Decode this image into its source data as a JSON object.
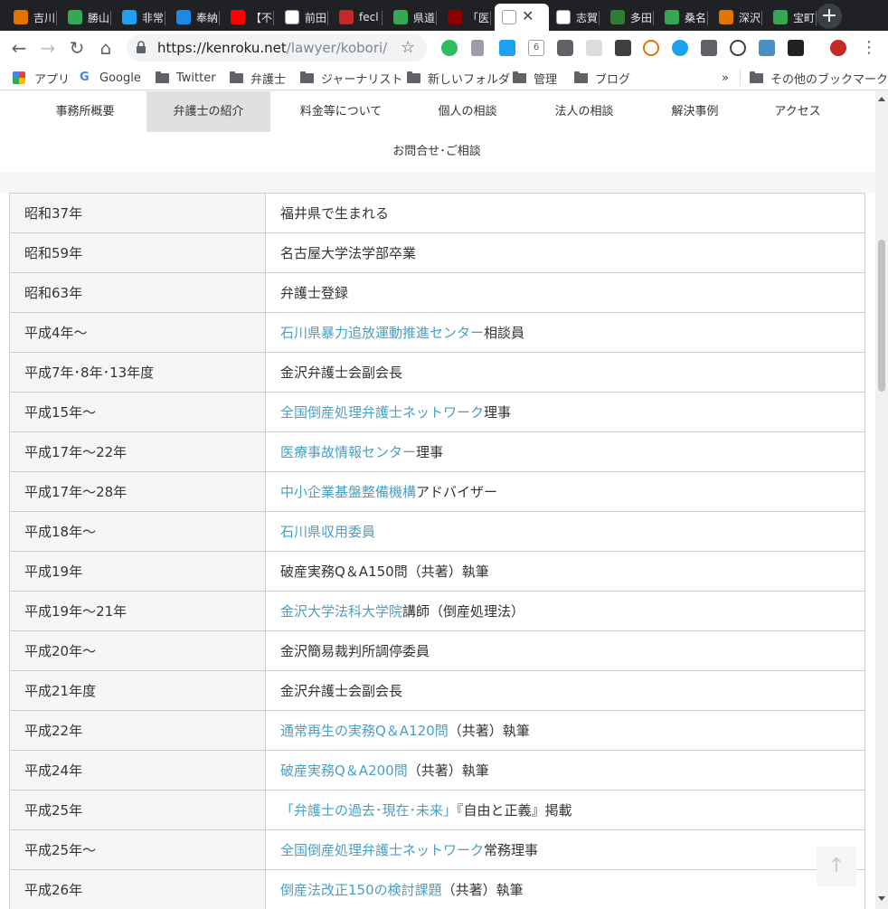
{
  "browser": {
    "tabs": [
      {
        "title": "吉川",
        "icon": "orange-sun-icon",
        "color": "#e37400"
      },
      {
        "title": "勝山",
        "icon": "maps-icon",
        "color": "#34a853"
      },
      {
        "title": "非常",
        "icon": "twitter-icon",
        "color": "#1da1f2"
      },
      {
        "title": "奉納",
        "icon": "blog-icon",
        "color": "#1e88e5"
      },
      {
        "title": "【不",
        "icon": "youtube-icon",
        "color": "#ff0000"
      },
      {
        "title": "前田",
        "icon": "google-icon",
        "color": "#ffffff"
      },
      {
        "title": "fecl",
        "icon": "f-icon",
        "color": "#c62828"
      },
      {
        "title": "県道",
        "icon": "maps-icon",
        "color": "#34a853"
      },
      {
        "title": "「医",
        "icon": "bug-icon",
        "color": "#8e0000"
      },
      {
        "title": "",
        "icon": "document-icon",
        "color": "#ffffff",
        "active": true
      },
      {
        "title": "志賀",
        "icon": "wikipedia-icon",
        "color": "#ffffff"
      },
      {
        "title": "多田",
        "icon": "bookmark-icon",
        "color": "#2e7d32"
      },
      {
        "title": "桑名",
        "icon": "maps-icon",
        "color": "#34a853"
      },
      {
        "title": "深沢",
        "icon": "orange-sun-icon",
        "color": "#e37400"
      },
      {
        "title": "宝町",
        "icon": "maps-icon",
        "color": "#34a853"
      }
    ],
    "url_host": "https://kenroku.net",
    "url_path": "/lawyer/kobori/",
    "bookmarks": [
      {
        "label": "アプリ",
        "type": "apps"
      },
      {
        "label": "Google",
        "type": "google"
      },
      {
        "label": "Twitter",
        "type": "folder"
      },
      {
        "label": "弁護士",
        "type": "folder"
      },
      {
        "label": "ジャーナリスト",
        "type": "folder"
      },
      {
        "label": "新しいフォルダ",
        "type": "folder"
      },
      {
        "label": "管理",
        "type": "folder"
      },
      {
        "label": "ブログ",
        "type": "folder"
      }
    ],
    "overflow": "»",
    "other_bookmarks": "その他のブックマーク"
  },
  "site_nav": [
    {
      "label": "事務所概要"
    },
    {
      "label": "弁護士の紹介",
      "active": true
    },
    {
      "label": "料金等について"
    },
    {
      "label": "個人の相談"
    },
    {
      "label": "法人の相談"
    },
    {
      "label": "解決事例"
    },
    {
      "label": "アクセス"
    },
    {
      "label": "お問合せ･ご相談"
    }
  ],
  "career": [
    {
      "year": "昭和37年",
      "parts": [
        {
          "text": "福井県で生まれる",
          "link": false
        }
      ]
    },
    {
      "year": "昭和59年",
      "parts": [
        {
          "text": "名古屋大学法学部卒業",
          "link": false
        }
      ]
    },
    {
      "year": "昭和63年",
      "parts": [
        {
          "text": "弁護士登録",
          "link": false
        }
      ]
    },
    {
      "year": "平成4年〜",
      "parts": [
        {
          "text": "石川県暴力追放運動推進センター",
          "link": true
        },
        {
          "text": "相談員",
          "link": false
        }
      ]
    },
    {
      "year": "平成7年･8年･13年度",
      "parts": [
        {
          "text": "金沢弁護士会副会長",
          "link": false
        }
      ]
    },
    {
      "year": "平成15年〜",
      "parts": [
        {
          "text": "全国倒産処理弁護士ネットワーク",
          "link": true
        },
        {
          "text": "理事",
          "link": false
        }
      ]
    },
    {
      "year": "平成17年〜22年",
      "parts": [
        {
          "text": "医療事故情報センター",
          "link": true
        },
        {
          "text": "理事",
          "link": false
        }
      ]
    },
    {
      "year": "平成17年〜28年",
      "parts": [
        {
          "text": "中小企業基盤整備機構",
          "link": true
        },
        {
          "text": "アドバイザー",
          "link": false
        }
      ]
    },
    {
      "year": "平成18年〜",
      "parts": [
        {
          "text": "石川県収用委員",
          "link": true
        }
      ]
    },
    {
      "year": "平成19年",
      "parts": [
        {
          "text": "破産実務Q＆A150問（共著）執筆",
          "link": false
        }
      ]
    },
    {
      "year": "平成19年〜21年",
      "parts": [
        {
          "text": "金沢大学法科大学院",
          "link": true
        },
        {
          "text": "講師（倒産処理法）",
          "link": false
        }
      ]
    },
    {
      "year": "平成20年〜",
      "parts": [
        {
          "text": "金沢簡易裁判所調停委員",
          "link": false
        }
      ]
    },
    {
      "year": "平成21年度",
      "parts": [
        {
          "text": "金沢弁護士会副会長",
          "link": false
        }
      ]
    },
    {
      "year": "平成22年",
      "parts": [
        {
          "text": "通常再生の実務Q＆A120問",
          "link": true
        },
        {
          "text": "（共著）執筆",
          "link": false
        }
      ]
    },
    {
      "year": "平成24年",
      "parts": [
        {
          "text": "破産実務Q＆A200問",
          "link": true
        },
        {
          "text": "（共著）執筆",
          "link": false
        }
      ]
    },
    {
      "year": "平成25年",
      "parts": [
        {
          "text": "「弁護士の過去･現在･未来」",
          "link": true
        },
        {
          "text": "『自由と正義』掲載",
          "link": false
        }
      ]
    },
    {
      "year": "平成25年〜",
      "parts": [
        {
          "text": "全国倒産処理弁護士ネットワーク",
          "link": true
        },
        {
          "text": "常務理事",
          "link": false
        }
      ]
    },
    {
      "year": "平成26年",
      "parts": [
        {
          "text": "倒産法改正150の検討課題",
          "link": true
        },
        {
          "text": "（共著）執筆",
          "link": false
        }
      ]
    }
  ],
  "to_top": "↑",
  "colors": {
    "link": "#4aa0c4",
    "year_bg": "#f6f6f6",
    "nav_active_bg": "#e0e0e0",
    "tabbar": "#202124"
  }
}
